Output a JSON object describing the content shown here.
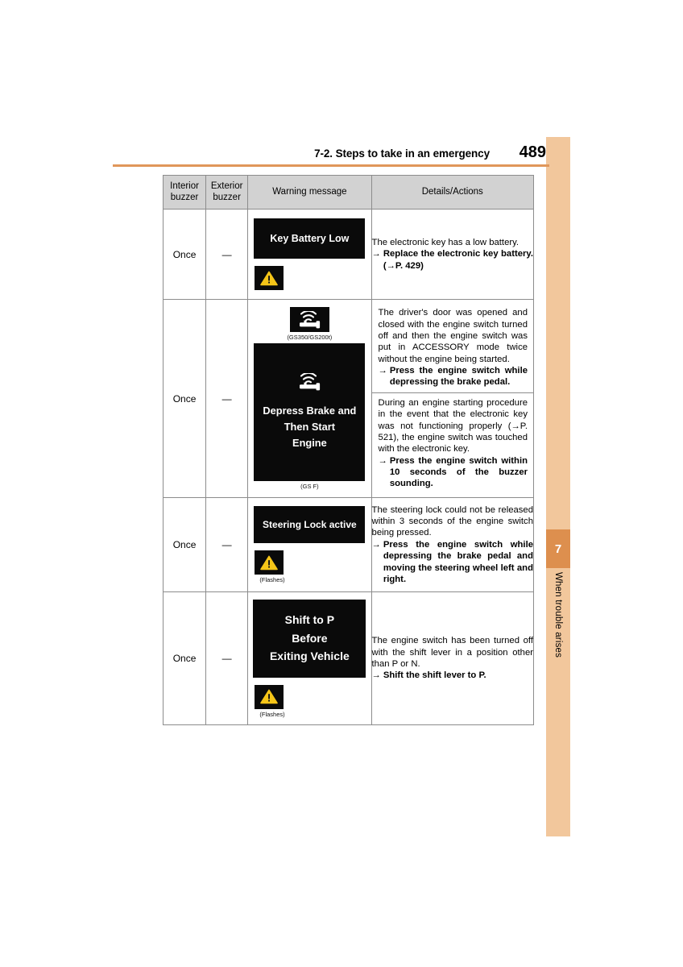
{
  "page": {
    "header_title": "7-2. Steps to take in an emergency",
    "page_number": "489",
    "chapter_number": "7",
    "chapter_label": "When trouble arises"
  },
  "table": {
    "headers": {
      "interior": "Interior buzzer",
      "exterior": "Exterior buzzer",
      "message": "Warning message",
      "details": "Details/Actions"
    },
    "rows": [
      {
        "interior": "Once",
        "exterior": "—",
        "display_lines": [
          "Key Battery Low"
        ],
        "warning_icon_caption": "",
        "details": [
          {
            "text": "The electronic key has a low battery.",
            "arrow": "→",
            "action": "Replace the electronic key battery. (→P. 429)"
          }
        ]
      },
      {
        "interior": "Once",
        "exterior": "—",
        "icon_caption_top": "(GS350/GS200t)",
        "display_lines": [
          "Depress Brake and",
          "Then Start",
          "Engine"
        ],
        "icon_caption_bottom": "(GS F)",
        "details": [
          {
            "text": "The driver's door was opened and closed with the engine switch turned off and then the engine switch was put in ACCESSORY mode twice without the engine being started.",
            "arrow": "→",
            "action": "Press the engine switch while depressing the brake pedal."
          },
          {
            "text": "During an engine starting procedure in the event that the electronic key was not functioning properly (→P. 521), the engine switch was touched with the electronic key.",
            "arrow": "→",
            "action": "Press the engine switch within 10 seconds of the buzzer sounding."
          }
        ]
      },
      {
        "interior": "Once",
        "exterior": "—",
        "display_lines": [
          "Steering Lock active"
        ],
        "warning_icon_caption": "(Flashes)",
        "details": [
          {
            "text": "The steering lock could not be released within 3 seconds of the engine switch being pressed.",
            "arrow": "→",
            "action": "Press the engine switch while depressing the brake pedal and moving the steering wheel left and right."
          }
        ]
      },
      {
        "interior": "Once",
        "exterior": "—",
        "display_lines": [
          "Shift to P",
          "Before",
          "Exiting Vehicle"
        ],
        "warning_icon_caption": "(Flashes)",
        "details": [
          {
            "text": "The engine switch has been turned off with the shift lever in a position other than P or N.",
            "arrow": "→",
            "action": "Shift the shift lever to P."
          }
        ]
      }
    ]
  },
  "colors": {
    "tab_light": "#f2c79c",
    "tab_dark": "#dd8f4e",
    "rule": "#e0975a",
    "header_fill": "#d2d2d2",
    "warning_yellow": "#f5c518"
  }
}
